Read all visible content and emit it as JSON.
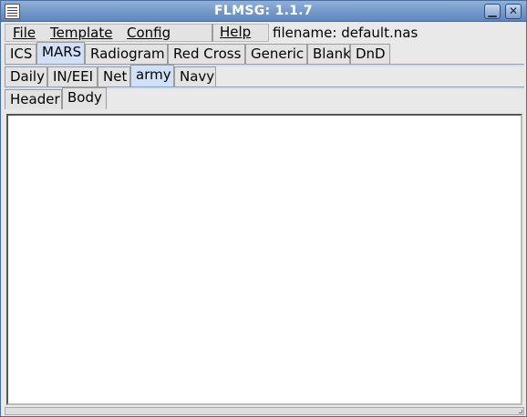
{
  "window": {
    "title": "FLMSG: 1.1.7",
    "minimize_glyph": "▁",
    "close_glyph": "✕"
  },
  "menu": {
    "file": "File",
    "template": "Template",
    "config": "Config",
    "help": "Help"
  },
  "filename": "filename: default.nas",
  "tabs_level1": [
    "ICS",
    "MARS",
    "Radiogram",
    "Red Cross",
    "Generic",
    "Blank",
    "DnD"
  ],
  "tabs_level2": [
    "Daily",
    "IN/EEI",
    "Net",
    "army",
    "Navy"
  ],
  "tabs_level3": [
    "Header",
    "Body"
  ],
  "body_text": "",
  "colors": {
    "title_bar": "#5d86bd",
    "selected_tab": "#cfe0f8",
    "panel": "#e9e9e9"
  }
}
